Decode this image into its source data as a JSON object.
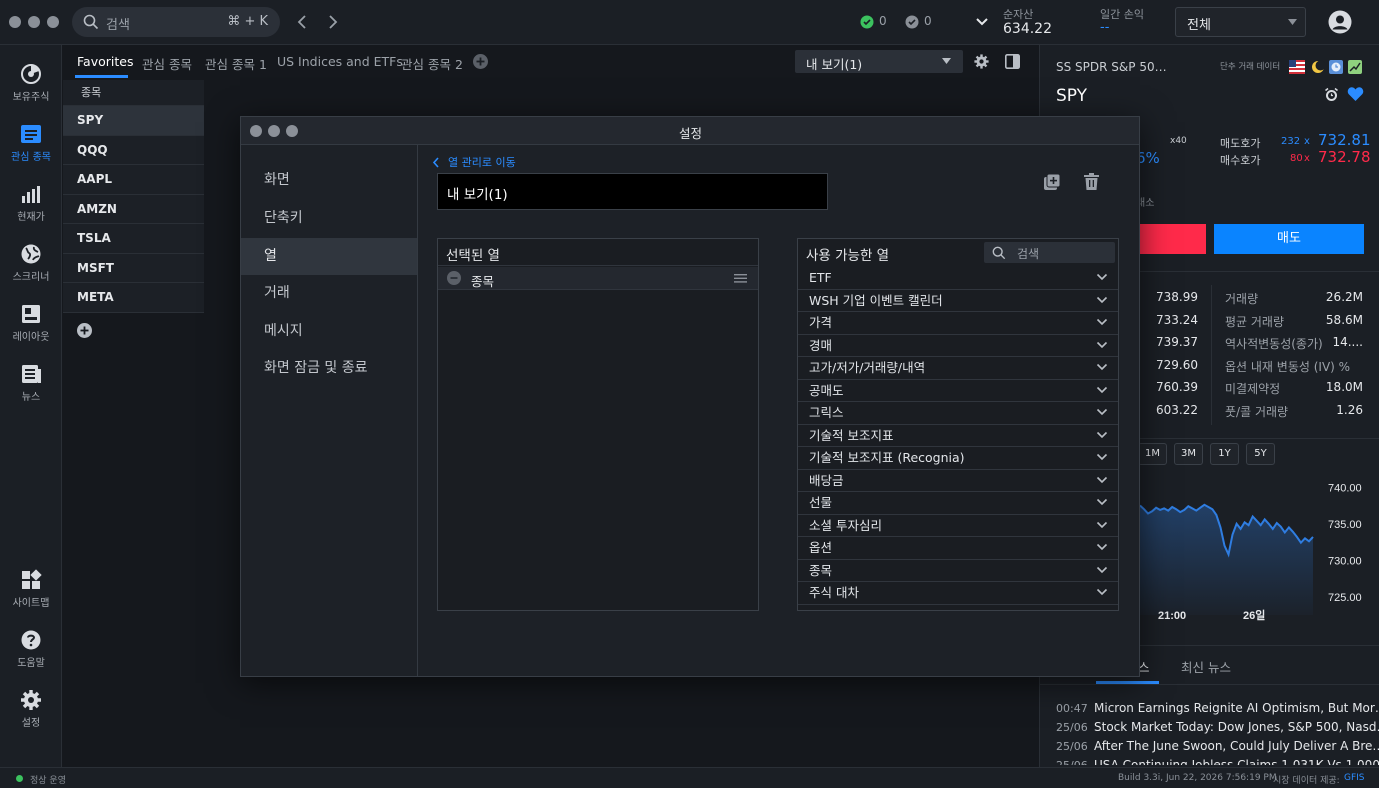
{
  "topbar": {
    "search_placeholder": "검색",
    "search_shortcut": "⌘ + K",
    "status_green_count": "0",
    "status_gray_count": "0",
    "net_assets_label": "순자산",
    "net_assets_value": "634.22",
    "daily_pl_label": "일간 손익",
    "daily_pl_value": "--",
    "account_select": "전체"
  },
  "sidebar": {
    "items": [
      {
        "label": "보유주식"
      },
      {
        "label": "관심 종목"
      },
      {
        "label": "현재가"
      },
      {
        "label": "스크리너"
      },
      {
        "label": "레이아웃"
      },
      {
        "label": "뉴스"
      },
      {
        "label": "사이트맵"
      },
      {
        "label": "도움말"
      },
      {
        "label": "설정"
      }
    ]
  },
  "watchlist": {
    "tabs": [
      "Favorites",
      "관심 종목",
      "관심 종목 1",
      "US Indices and ETFs",
      "관심 종목 2"
    ],
    "view_select": "내 보기(1)",
    "column_header": "종목",
    "symbols": [
      "SPY",
      "QQQ",
      "AAPL",
      "AMZN",
      "TSLA",
      "MSFT",
      "META"
    ]
  },
  "right_panel": {
    "company_name": "SS SPDR S&P 50…",
    "data_label": "단추 거래 데이터",
    "symbol": "SPY",
    "multiplier": "x40",
    "bid_label": "매도호가",
    "ask_label": "매수호가",
    "bid_size": "232",
    "bid_x": "x",
    "bid_price": "732.81",
    "ask_size": "80",
    "ask_x": "x",
    "ask_price": "732.78",
    "pct_fragment": "6%",
    "exchange_fragment": "래소",
    "sell_button": "매도",
    "left_values": [
      "738.99",
      "733.24",
      "739.37",
      "729.60",
      "760.39",
      "603.22"
    ],
    "stats": [
      {
        "label": "거래량",
        "value": "26.2M"
      },
      {
        "label": "평균 거래량",
        "value": "58.6M"
      },
      {
        "label": "역사적변동성(종가)",
        "value": "14...."
      },
      {
        "label": "옵션 내재 변동성 (IV) %",
        "value": ""
      },
      {
        "label": "미결제약정",
        "value": "18.0M"
      },
      {
        "label": "풋/콜 거래량",
        "value": "1.26"
      }
    ],
    "range_buttons": [
      "1M",
      "3M",
      "1Y",
      "5Y"
    ],
    "news_tab_partial": "스",
    "news_tab_latest": "최신 뉴스",
    "news": [
      {
        "time": "00:47",
        "headline": "Micron Earnings Reignite AI Optimism, But Mor…"
      },
      {
        "time": "25/06",
        "headline": "Stock Market Today: Dow Jones, S&P 500, Nasd…"
      },
      {
        "time": "25/06",
        "headline": "After The June Swoon, Could July Deliver A Bre…"
      },
      {
        "time": "25/06",
        "headline": "USA Continuing Jobless Claims 1.031K Vs 1.000…"
      }
    ]
  },
  "chart_data": {
    "type": "line",
    "title": "",
    "xlabel": "",
    "ylabel": "",
    "x_tick_labels": [
      "21:00",
      "26일"
    ],
    "y_tick_labels": [
      "740.00",
      "735.00",
      "730.00",
      "725.00"
    ],
    "ylim": [
      722.5,
      742.5
    ],
    "series": [
      {
        "color": "#2f7de1",
        "values": [
          737.5,
          737.0,
          736.4,
          736.7,
          737.2,
          736.9,
          737.1,
          736.8,
          737.3,
          737.0,
          736.6,
          736.9,
          737.4,
          737.1,
          736.8,
          737.2,
          737.6,
          737.3,
          737.0,
          736.2,
          734.5,
          732.0,
          730.8,
          733.5,
          735.0,
          734.3,
          735.2,
          734.8,
          736.0,
          735.4,
          734.8,
          735.6,
          735.0,
          734.3,
          735.1,
          734.6,
          733.8,
          734.5,
          733.9,
          733.2,
          732.4,
          733.0,
          732.6,
          733.2
        ]
      }
    ],
    "grid": false,
    "legend": "none"
  },
  "modal": {
    "title": "설정",
    "nav": [
      "화면",
      "단축키",
      "열",
      "거래",
      "메시지",
      "화면 잠금 및 종료"
    ],
    "back_link": "열 관리로 이동",
    "view_name": "내 보기(1)",
    "selected_title": "선택된 열",
    "selected_items": [
      "종목"
    ],
    "available_title": "사용 가능한 열",
    "available_search_placeholder": "검색",
    "available_categories": [
      "ETF",
      "WSH 기업 이벤트 캘린더",
      "가격",
      "경매",
      "고가/저가/거래량/내역",
      "공매도",
      "그릭스",
      "기술적 보조지표",
      "기술적 보조지표 (Recognia)",
      "배당금",
      "선물",
      "소셜 투자심리",
      "옵션",
      "종목",
      "주식 대차"
    ]
  },
  "statusbar": {
    "status": "정상 운영",
    "build": "Build 3.3i, Jun 22, 2026 7:56:19 PM",
    "data_provider_label": "시장 데이터 제공:",
    "data_provider": "GFIS"
  },
  "colors": {
    "accent": "#2b8cff",
    "sell": "#ff2a4a",
    "buy": "#0a84ff",
    "up": "#3cc25f",
    "chart_line": "#2f7de1"
  }
}
